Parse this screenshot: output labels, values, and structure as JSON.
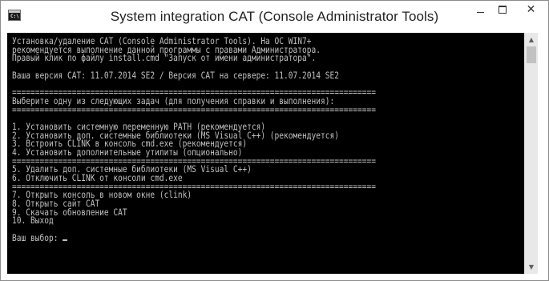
{
  "window": {
    "title": "System integration CAT (Console Administrator Tools)",
    "icon": "console-icon",
    "controls": {
      "minimize_icon": "minimize-icon",
      "maximize_icon": "maximize-icon",
      "close_icon": "close-icon",
      "close_glyph": "✕"
    }
  },
  "console": {
    "background": "#000000",
    "text_color": "#c0c0c0",
    "lines": [
      "Установка/удаление CAT (Console Administrator Tools). На ОС WIN7+",
      "рекомендуется выполнение данной программы с правами Администратора.",
      "Правый клик по файлу install.cmd \"Запуск от имени администратора\".",
      "",
      "Ваша версия CAT: 11.07.2014 SE2 / Версия CAT на сервере: 11.07.2014 SE2",
      "",
      "===============================================================================",
      "Выберите одну из следующих задач (для получения справки и выполнения):",
      "===============================================================================",
      "",
      "1. Установить системную переменную PATH (рекомендуется)",
      "2. Установить доп. системные библиотеки (MS Visual C++) (рекомендуется)",
      "3. Встроить CLINK в консоль cmd.exe (рекомендуется)",
      "4. Установить дополнительные утилиты (опционально)",
      "===============================================================================",
      "5. Удалить доп. системные библиотеки (MS Visual C++)",
      "6. Отключить CLINK от консоли cmd.exe",
      "===============================================================================",
      "7. Открыть консоль в новом окне (clink)",
      "8. Открыть сайт CAT",
      "9. Скачать обновление CAT",
      "10. Выход",
      "",
      "Ваш выбор:"
    ]
  },
  "scrollbar": {
    "up_arrow": "▲",
    "down_arrow": "▼",
    "up_icon": "scroll-up-arrow-icon",
    "down_icon": "scroll-down-arrow-icon"
  }
}
